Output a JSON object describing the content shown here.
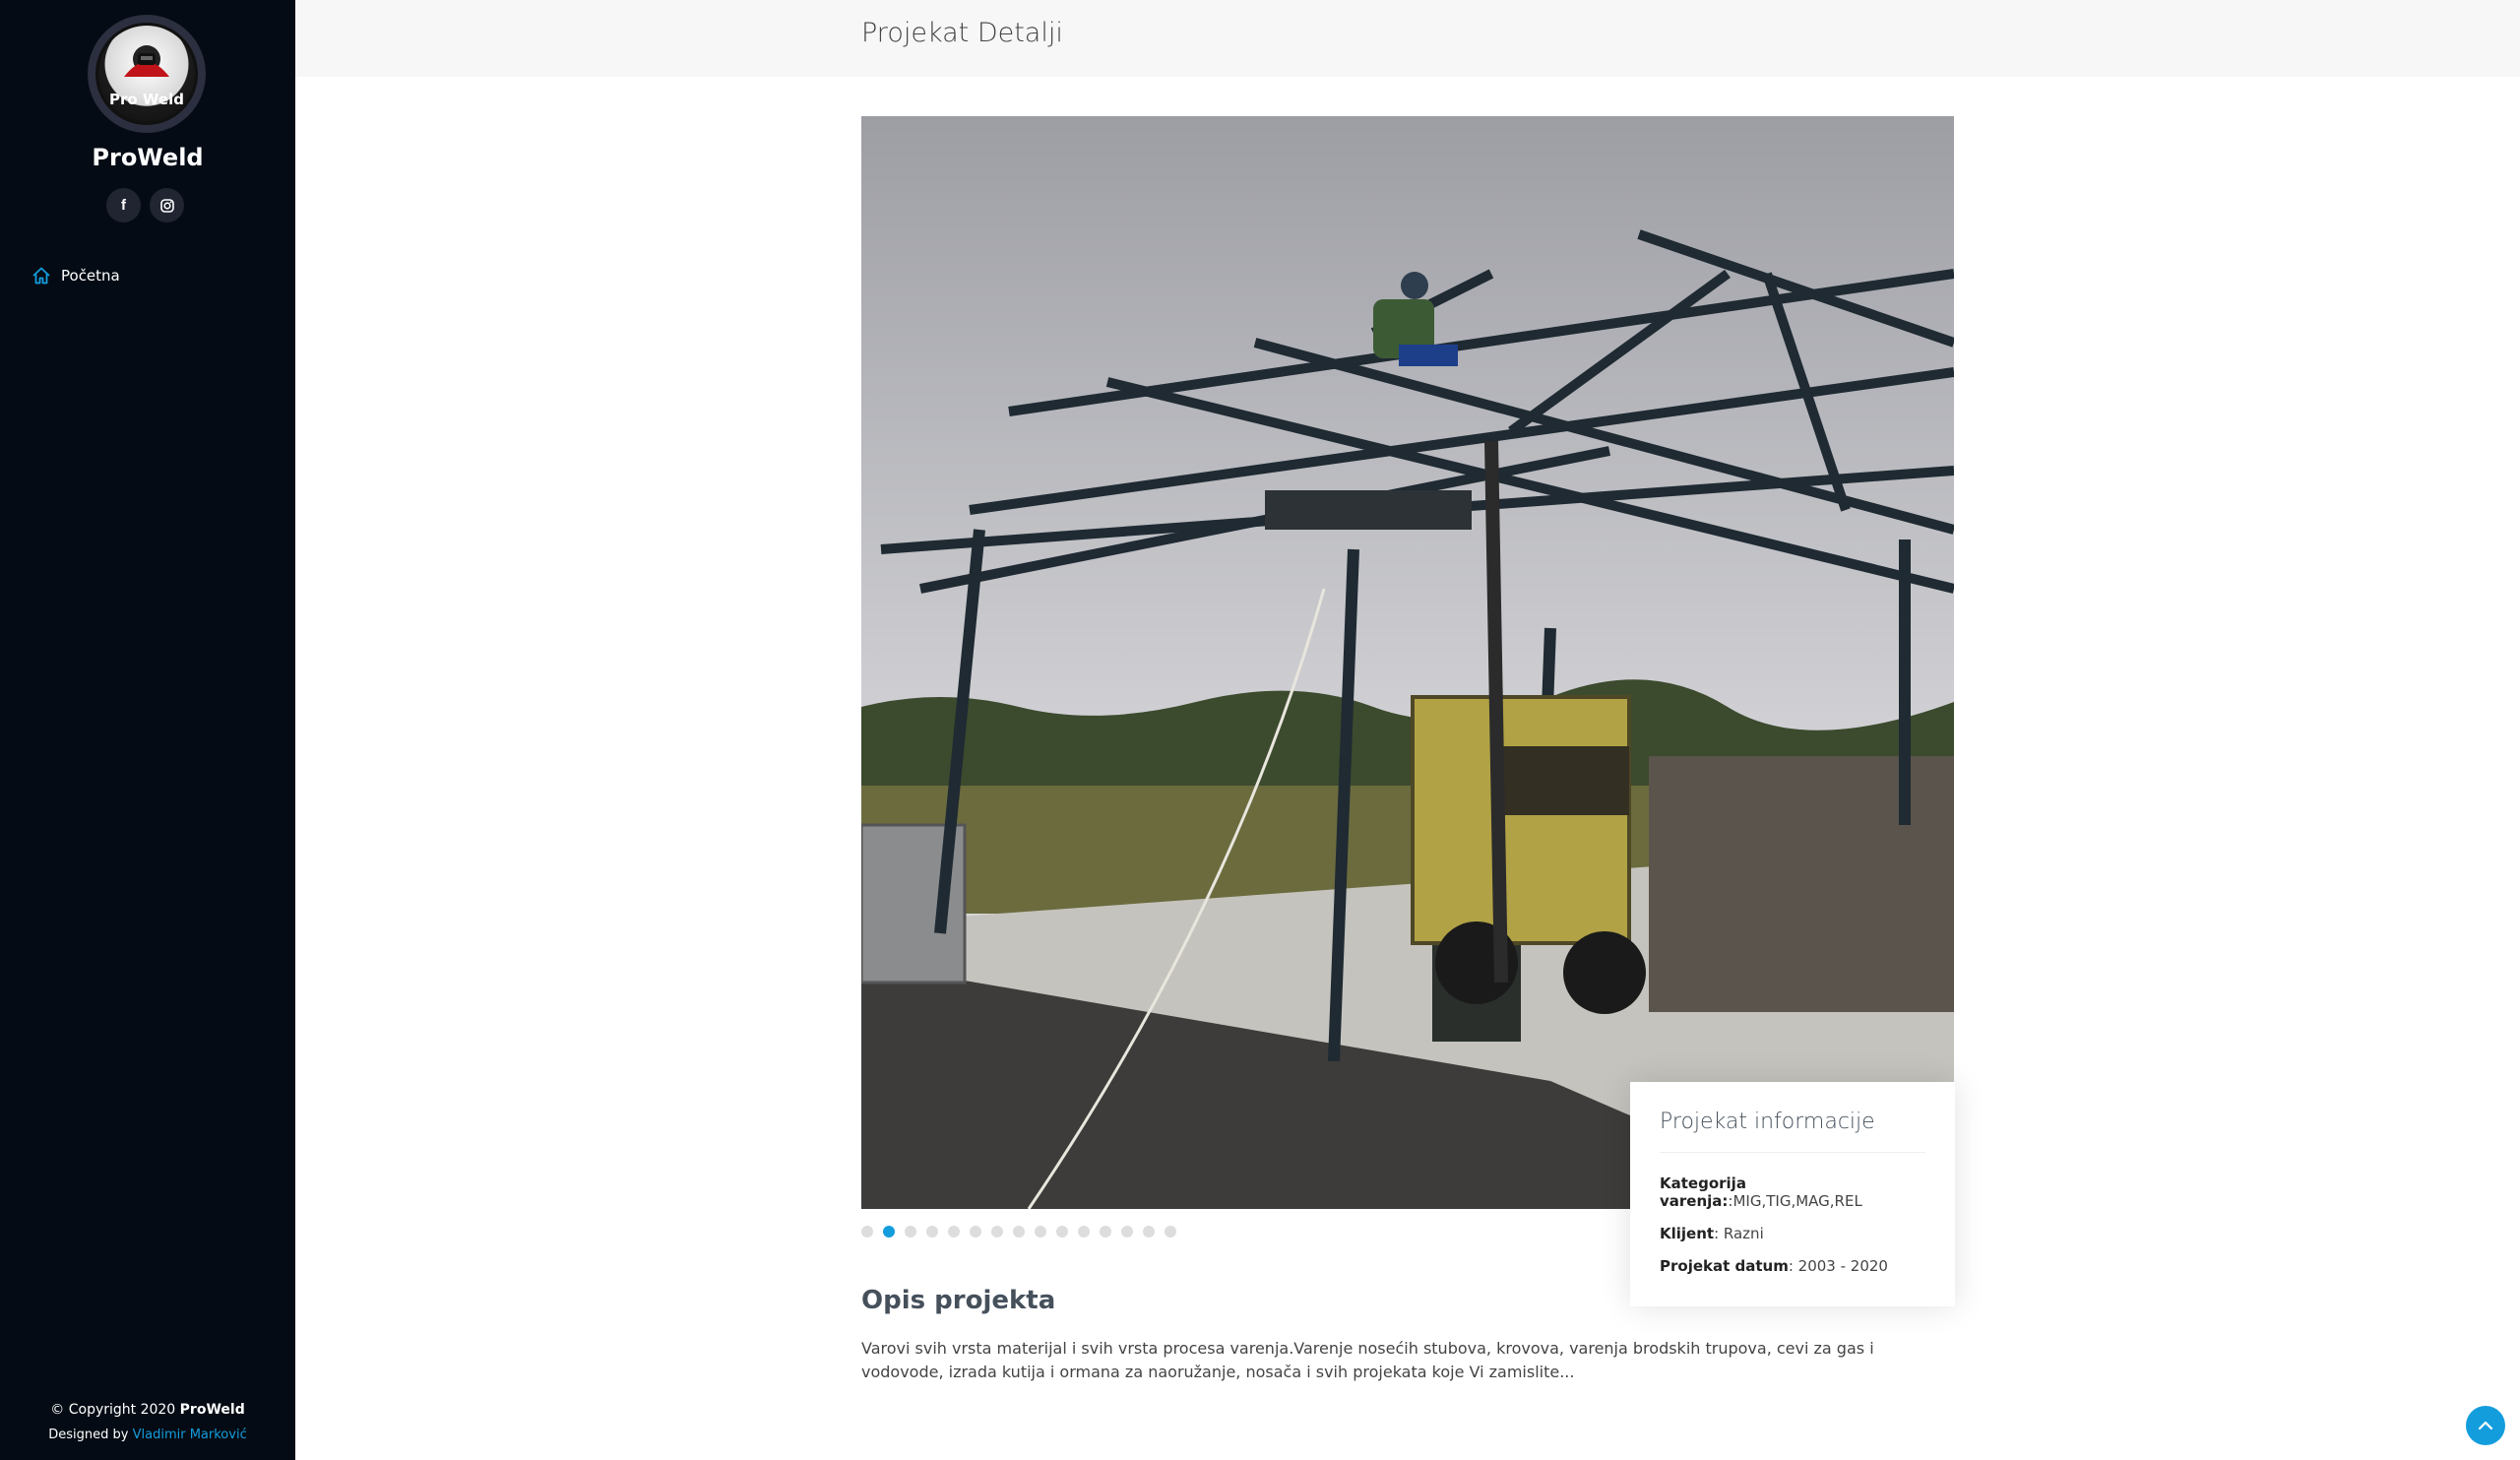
{
  "sidebar": {
    "logo_text": "Pro Weld",
    "brand": "ProWeld",
    "socials": [
      {
        "name": "facebook",
        "glyph": "f"
      },
      {
        "name": "instagram",
        "glyph": "◎"
      }
    ],
    "nav": [
      {
        "label": "Početna",
        "icon": "home-icon"
      }
    ],
    "copyright_prefix": "© Copyright 2020",
    "copyright_brand": "ProWeld",
    "designed_by": "Designed by",
    "designer": "Vladimir Marković"
  },
  "header": {
    "title": "Projekat Detalji"
  },
  "carousel": {
    "count": 15,
    "active_index": 1
  },
  "info": {
    "title": "Projekat informacije",
    "category_label": "Kategorija varenja:",
    "category_value": ":MIG,TIG,MAG,REL",
    "client_label": "Klijent",
    "client_value": ": Razni",
    "date_label": "Projekat datum",
    "date_value": ": 2003 - 2020"
  },
  "description": {
    "title": "Opis projekta",
    "text": "Varovi svih vrsta materijal i svih vrsta procesa varenja.Varenje nosećih stubova, krovova, varenja brodskih trupova, cevi za gas i vodovode, izrada kutija i ormana za naoružanje, nosača i svih projekata koje Vi zamislite..."
  },
  "colors": {
    "accent": "#149ddd",
    "sidebar_bg": "#040b14"
  }
}
